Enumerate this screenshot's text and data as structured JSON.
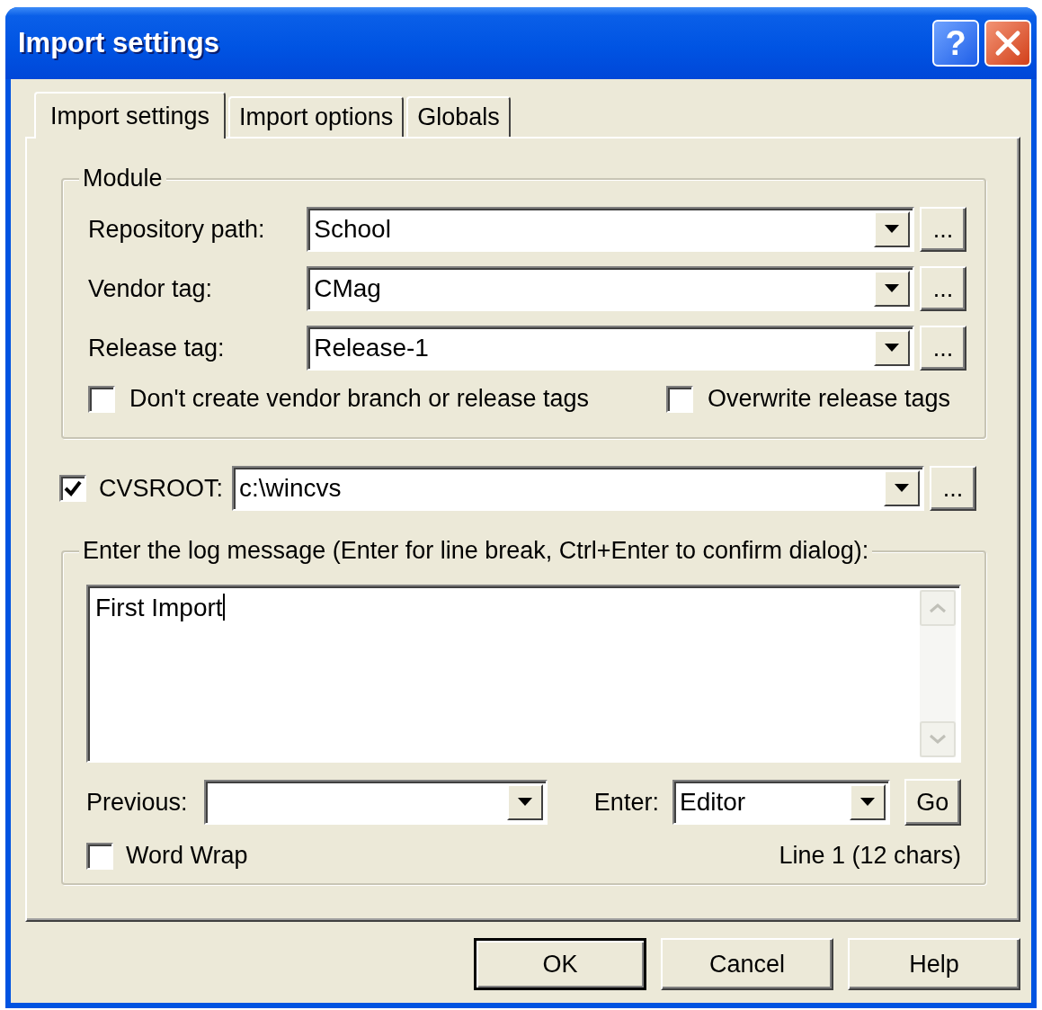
{
  "window": {
    "title": "Import settings",
    "help_button": "?"
  },
  "tabs": [
    {
      "label": "Import settings",
      "selected": true
    },
    {
      "label": "Import options",
      "selected": false
    },
    {
      "label": "Globals",
      "selected": false
    }
  ],
  "module": {
    "title": "Module",
    "fields": [
      {
        "label": "Repository path:",
        "value": "School",
        "browse": "..."
      },
      {
        "label": "Vendor tag:",
        "value": "CMag",
        "browse": "..."
      },
      {
        "label": "Release tag:",
        "value": "Release-1",
        "browse": "..."
      }
    ],
    "options": [
      {
        "label": "Don't create vendor branch or release tags",
        "checked": false
      },
      {
        "label": "Overwrite release tags",
        "checked": false
      }
    ]
  },
  "cvsroot": {
    "label": "CVSROOT:",
    "checked": true,
    "value": "c:\\wincvs",
    "browse": "..."
  },
  "log": {
    "title": "Enter the log message (Enter for line break, Ctrl+Enter to confirm dialog):",
    "message": "First Import",
    "previous_label": "Previous:",
    "enter_label": "Enter:",
    "enter_value": "Editor",
    "go": "Go",
    "word_wrap": {
      "label": "Word Wrap",
      "checked": false
    },
    "status": "Line 1 (12 chars)"
  },
  "buttons": [
    {
      "label": "OK",
      "default": true
    },
    {
      "label": "Cancel",
      "default": false
    },
    {
      "label": "Help",
      "default": false
    }
  ]
}
